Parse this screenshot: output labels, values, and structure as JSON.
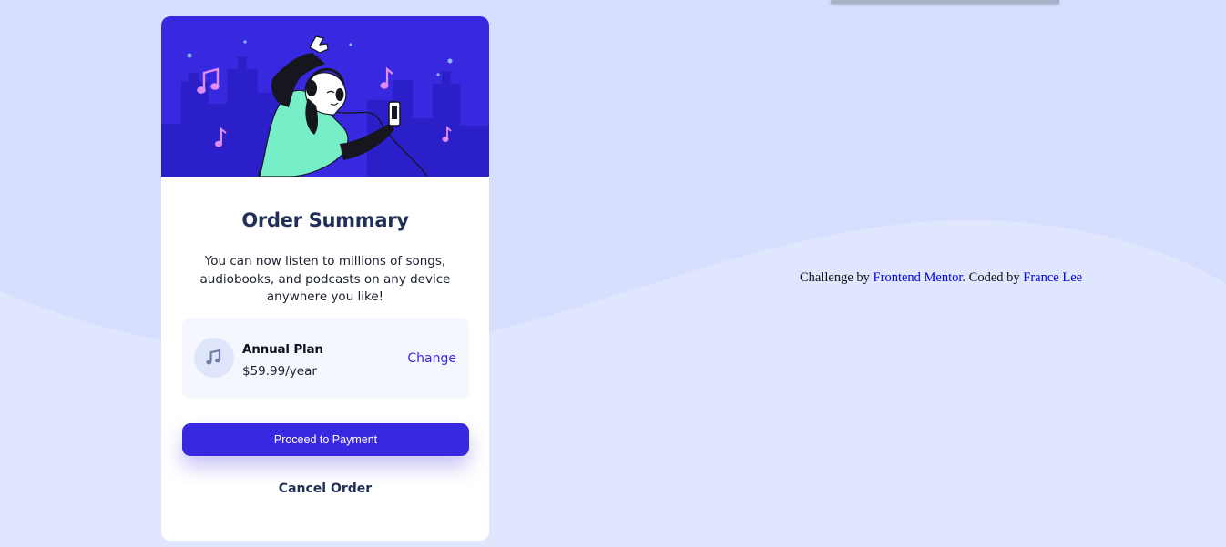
{
  "colors": {
    "page_background": "#d6e0fe",
    "wave_background": "#e0e6fd",
    "primary": "#3829e0",
    "heading": "#1f2f56",
    "hero_accent": "#76efc8"
  },
  "card": {
    "title": "Order Summary",
    "description": "You can now listen to millions of songs, audiobooks, and podcasts on any device anywhere you like!",
    "plan": {
      "icon": "music-note-icon",
      "name": "Annual Plan",
      "price": "$59.99/year",
      "change_label": "Change"
    },
    "pay_button_label": "Proceed to Payment",
    "cancel_label": "Cancel Order"
  },
  "attribution": {
    "prefix": "Challenge by ",
    "link1": "Frontend Mentor",
    "middle": ". Coded by ",
    "link2": "France Lee"
  }
}
